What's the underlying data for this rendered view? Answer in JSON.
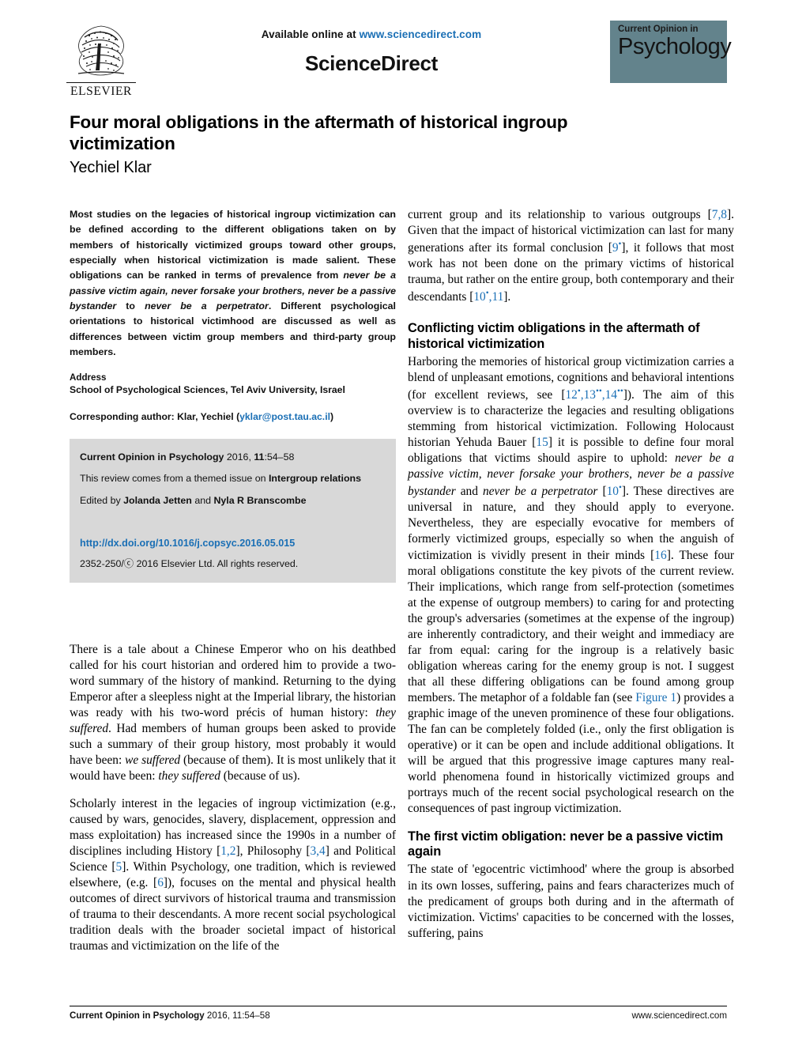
{
  "masthead": {
    "available_prefix": "Available online at ",
    "available_url": "www.sciencedirect.com",
    "wordmark": "ScienceDirect",
    "publisher": "ELSEVIER",
    "journal_badge_top": "Current Opinion in",
    "journal_badge_main": "Psychology",
    "badge_color": "#63838c"
  },
  "title_block": {
    "title": "Four moral obligations in the aftermath of historical ingroup victimization",
    "author": "Yechiel Klar"
  },
  "abstract": {
    "part1": "Most studies on the legacies of historical ingroup victimization can be defined according to the different obligations taken on by members of historically victimized groups toward other groups, especially when historical victimization is made salient. These obligations can be ranked in terms of prevalence from ",
    "italic1": "never be a passive victim again, never forsake your brothers, never be a passive bystander",
    "mid1": " to ",
    "italic2": "never be a perpetrator",
    "part2": ". Different psychological orientations to historical victimhood are discussed as well as differences between victim group members and third-party group members."
  },
  "address": {
    "heading": "Address",
    "line": "School of Psychological Sciences, Tel Aviv University, Israel",
    "corresponding_prefix": "Corresponding author: Klar, Yechiel (",
    "corresponding_email": "yklar@post.tau.ac.il",
    "corresponding_suffix": ")"
  },
  "citation_box": {
    "journal": "Current Opinion in Psychology",
    "year_vol": " 2016, ",
    "volume": "11",
    "pages": ":54–58",
    "themed_prefix": "This review comes from a themed issue on ",
    "themed_issue": "Intergroup relations",
    "edited_prefix": "Edited by ",
    "editor1": "Jolanda Jetten",
    "edited_mid": " and ",
    "editor2": "Nyla R Branscombe",
    "doi": "http://dx.doi.org/10.1016/j.copsyc.2016.05.015",
    "issn_line": "2352-250/ⓒ 2016 Elsevier Ltd. All rights reserved."
  },
  "left_column": {
    "paragraphs": [
      {
        "runs": [
          {
            "t": "There is a tale about a Chinese Emperor who on his deathbed called for his court historian and ordered him to provide a two-word summary of the history of mankind. Returning to the dying Emperor after a sleepless night at the Imperial library, the historian was ready with his two-word précis of human history: ",
            "s": "n"
          },
          {
            "t": "they suffered",
            "s": "i"
          },
          {
            "t": ". Had members of human groups been asked to provide such a summary of their group history, most probably it would have been: ",
            "s": "n"
          },
          {
            "t": "we suffered",
            "s": "i"
          },
          {
            "t": " (because of them). It is most unlikely that it would have been: ",
            "s": "n"
          },
          {
            "t": "they suffered",
            "s": "i"
          },
          {
            "t": " (because of us).",
            "s": "n"
          }
        ]
      },
      {
        "runs": [
          {
            "t": "Scholarly interest in the legacies of ingroup victimization (e.g., caused by wars, genocides, slavery, displacement, oppression and mass exploitation) has increased since the 1990s in a number of disciplines including History [",
            "s": "n"
          },
          {
            "t": "1,2",
            "s": "r"
          },
          {
            "t": "], Philosophy [",
            "s": "n"
          },
          {
            "t": "3,4",
            "s": "r"
          },
          {
            "t": "] and Political Science [",
            "s": "n"
          },
          {
            "t": "5",
            "s": "r"
          },
          {
            "t": "]. Within Psychology, one tradition, which is reviewed elsewhere, (e.g. [",
            "s": "n"
          },
          {
            "t": "6",
            "s": "r"
          },
          {
            "t": "]), focuses on the mental and physical health outcomes of direct survivors of historical trauma and transmission of trauma to their descendants. A more recent social psychological tradition deals with the broader societal impact of historical traumas and victimization on the life of the",
            "s": "n"
          }
        ]
      }
    ]
  },
  "right_column": {
    "intro": {
      "runs": [
        {
          "t": "current group and its relationship to various outgroups [",
          "s": "n"
        },
        {
          "t": "7,8",
          "s": "r"
        },
        {
          "t": "]. Given that the impact of historical victimization can last for many generations after its formal conclusion [",
          "s": "n"
        },
        {
          "t": "9",
          "s": "r"
        },
        {
          "t": "•",
          "s": "rs"
        },
        {
          "t": "], it follows that most work has not been done on the primary victims of historical trauma, but rather on the entire group, both contemporary and their descendants [",
          "s": "n"
        },
        {
          "t": "10",
          "s": "r"
        },
        {
          "t": "•",
          "s": "rs"
        },
        {
          "t": ",11",
          "s": "r"
        },
        {
          "t": "].",
          "s": "n"
        }
      ]
    },
    "section1_heading": "Conflicting victim obligations in the aftermath of historical victimization",
    "section1_paragraph": {
      "runs": [
        {
          "t": "Harboring the memories of historical group victimization carries a blend of unpleasant emotions, cognitions and behavioral intentions (for excellent reviews, see [",
          "s": "n"
        },
        {
          "t": "12",
          "s": "r"
        },
        {
          "t": "•",
          "s": "rs"
        },
        {
          "t": ",13",
          "s": "r"
        },
        {
          "t": "••",
          "s": "rs"
        },
        {
          "t": ",14",
          "s": "r"
        },
        {
          "t": "••",
          "s": "rs"
        },
        {
          "t": "]). The aim of this overview is to characterize the legacies and resulting obligations stemming from historical victimization. Following Holocaust historian Yehuda Bauer [",
          "s": "n"
        },
        {
          "t": "15",
          "s": "r"
        },
        {
          "t": "] it is possible to define four moral obligations that victims should aspire to uphold: ",
          "s": "n"
        },
        {
          "t": "never be a passive victim, never forsake your brothers, never be a passive bystander",
          "s": "i"
        },
        {
          "t": " and ",
          "s": "n"
        },
        {
          "t": "never be a perpetrator",
          "s": "i"
        },
        {
          "t": " [",
          "s": "n"
        },
        {
          "t": "10",
          "s": "r"
        },
        {
          "t": "•",
          "s": "rs"
        },
        {
          "t": "]. These directives are universal in nature, and they should apply to everyone. Nevertheless, they are especially evocative for members of formerly victimized groups, especially so when the anguish of victimization is vividly present in their minds [",
          "s": "n"
        },
        {
          "t": "16",
          "s": "r"
        },
        {
          "t": "]. These four moral obligations constitute the key pivots of the current review. Their implications, which range from self-protection (sometimes at the expense of outgroup members) to caring for and protecting the group's adversaries (sometimes at the expense of the ingroup) are inherently contradictory, and their weight and immediacy are far from equal: caring for the ingroup is a relatively basic obligation whereas caring for the enemy group is not. I suggest that all these differing obligations can be found among group members. The metaphor of a foldable fan (see ",
          "s": "n"
        },
        {
          "t": "Figure 1",
          "s": "r"
        },
        {
          "t": ") provides a graphic image of the uneven prominence of these four obligations. The fan can be completely folded (i.e., only the first obligation is operative) or it can be open and include additional obligations. It will be argued that this progressive image captures many real-world phenomena found in historically victimized groups and portrays much of the recent social psychological research on the consequences of past ingroup victimization.",
          "s": "n"
        }
      ]
    },
    "section2_heading": "The first victim obligation: never be a passive victim again",
    "section2_paragraph": {
      "runs": [
        {
          "t": "The state of 'egocentric victimhood' where the group is absorbed in its own losses, suffering, pains and fears characterizes much of the predicament of groups both during and in the aftermath of victimization. Victims' capacities to be concerned with the losses, suffering, pains",
          "s": "n"
        }
      ]
    }
  },
  "footer": {
    "left_bold": "Current Opinion in Psychology",
    "left_rest": " 2016, 11:54–58",
    "right": "www.sciencedirect.com"
  }
}
